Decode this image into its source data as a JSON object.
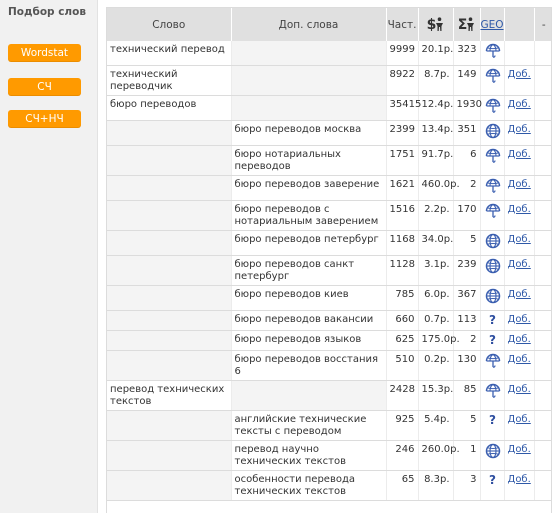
{
  "sidebar": {
    "title": "Подбор слов",
    "buttons": [
      "Wordstat",
      "СЧ",
      "СЧ+НЧ"
    ]
  },
  "columns": {
    "word": "Слово",
    "extra": "Доп. слова",
    "freq": "Част.",
    "price_icon": "$",
    "sum_icon": "Σ",
    "geo": "GEO",
    "dash": "-"
  },
  "colors": {
    "accent": "#ff9a00",
    "link": "#2f59a8",
    "globe": "#3b5fb0"
  },
  "rows": [
    {
      "word": "технический перевод",
      "extra": "",
      "freq": "9999",
      "price": "20.1р.",
      "sum": "323",
      "geo": "globe-partial",
      "add": ""
    },
    {
      "word": "технический переводчик",
      "extra": "",
      "freq": "8922",
      "price": "8.7р.",
      "sum": "149",
      "geo": "globe-partial",
      "add": "Доб."
    },
    {
      "word": "бюро переводов",
      "extra": "",
      "freq": "35415",
      "price": "12.4р.",
      "sum": "1930",
      "geo": "globe-partial",
      "add": "Доб."
    },
    {
      "word": "",
      "extra": "бюро переводов москва",
      "freq": "2399",
      "price": "13.4р.",
      "sum": "351",
      "geo": "globe-full",
      "add": "Доб."
    },
    {
      "word": "",
      "extra": "бюро нотариальных переводов",
      "freq": "1751",
      "price": "91.7р.",
      "sum": "6",
      "geo": "globe-partial",
      "add": "Доб."
    },
    {
      "word": "",
      "extra": "бюро переводов заверение",
      "freq": "1621",
      "price": "460.0р.",
      "sum": "2",
      "geo": "globe-partial",
      "add": "Доб."
    },
    {
      "word": "",
      "extra": "бюро переводов с нотариальным заверением",
      "freq": "1516",
      "price": "2.2р.",
      "sum": "170",
      "geo": "globe-partial",
      "add": "Доб."
    },
    {
      "word": "",
      "extra": "бюро переводов петербург",
      "freq": "1168",
      "price": "34.0р.",
      "sum": "5",
      "geo": "globe-full",
      "add": "Доб."
    },
    {
      "word": "",
      "extra": "бюро переводов санкт петербург",
      "freq": "1128",
      "price": "3.1р.",
      "sum": "239",
      "geo": "globe-full",
      "add": "Доб."
    },
    {
      "word": "",
      "extra": "бюро переводов киев",
      "freq": "785",
      "price": "6.0р.",
      "sum": "367",
      "geo": "globe-full",
      "add": "Доб."
    },
    {
      "word": "",
      "extra": "бюро переводов вакансии",
      "freq": "660",
      "price": "0.7р.",
      "sum": "113",
      "geo": "question",
      "add": "Доб."
    },
    {
      "word": "",
      "extra": "бюро переводов языков",
      "freq": "625",
      "price": "175.0р.",
      "sum": "2",
      "geo": "question",
      "add": "Доб."
    },
    {
      "word": "",
      "extra": "бюро переводов восстания 6",
      "freq": "510",
      "price": "0.2р.",
      "sum": "130",
      "geo": "globe-partial",
      "add": "Доб."
    },
    {
      "word": "перевод технических текстов",
      "extra": "",
      "freq": "2428",
      "price": "15.3р.",
      "sum": "85",
      "geo": "globe-partial",
      "add": "Доб."
    },
    {
      "word": "",
      "extra": "английские технические тексты с переводом",
      "freq": "925",
      "price": "5.4р.",
      "sum": "5",
      "geo": "question",
      "add": "Доб."
    },
    {
      "word": "",
      "extra": "перевод научно технических текстов",
      "freq": "246",
      "price": "260.0р.",
      "sum": "1",
      "geo": "globe-full",
      "add": "Доб."
    },
    {
      "word": "",
      "extra": "особенности перевода технических текстов",
      "freq": "65",
      "price": "8.3р.",
      "sum": "3",
      "geo": "question",
      "add": "Доб."
    }
  ]
}
